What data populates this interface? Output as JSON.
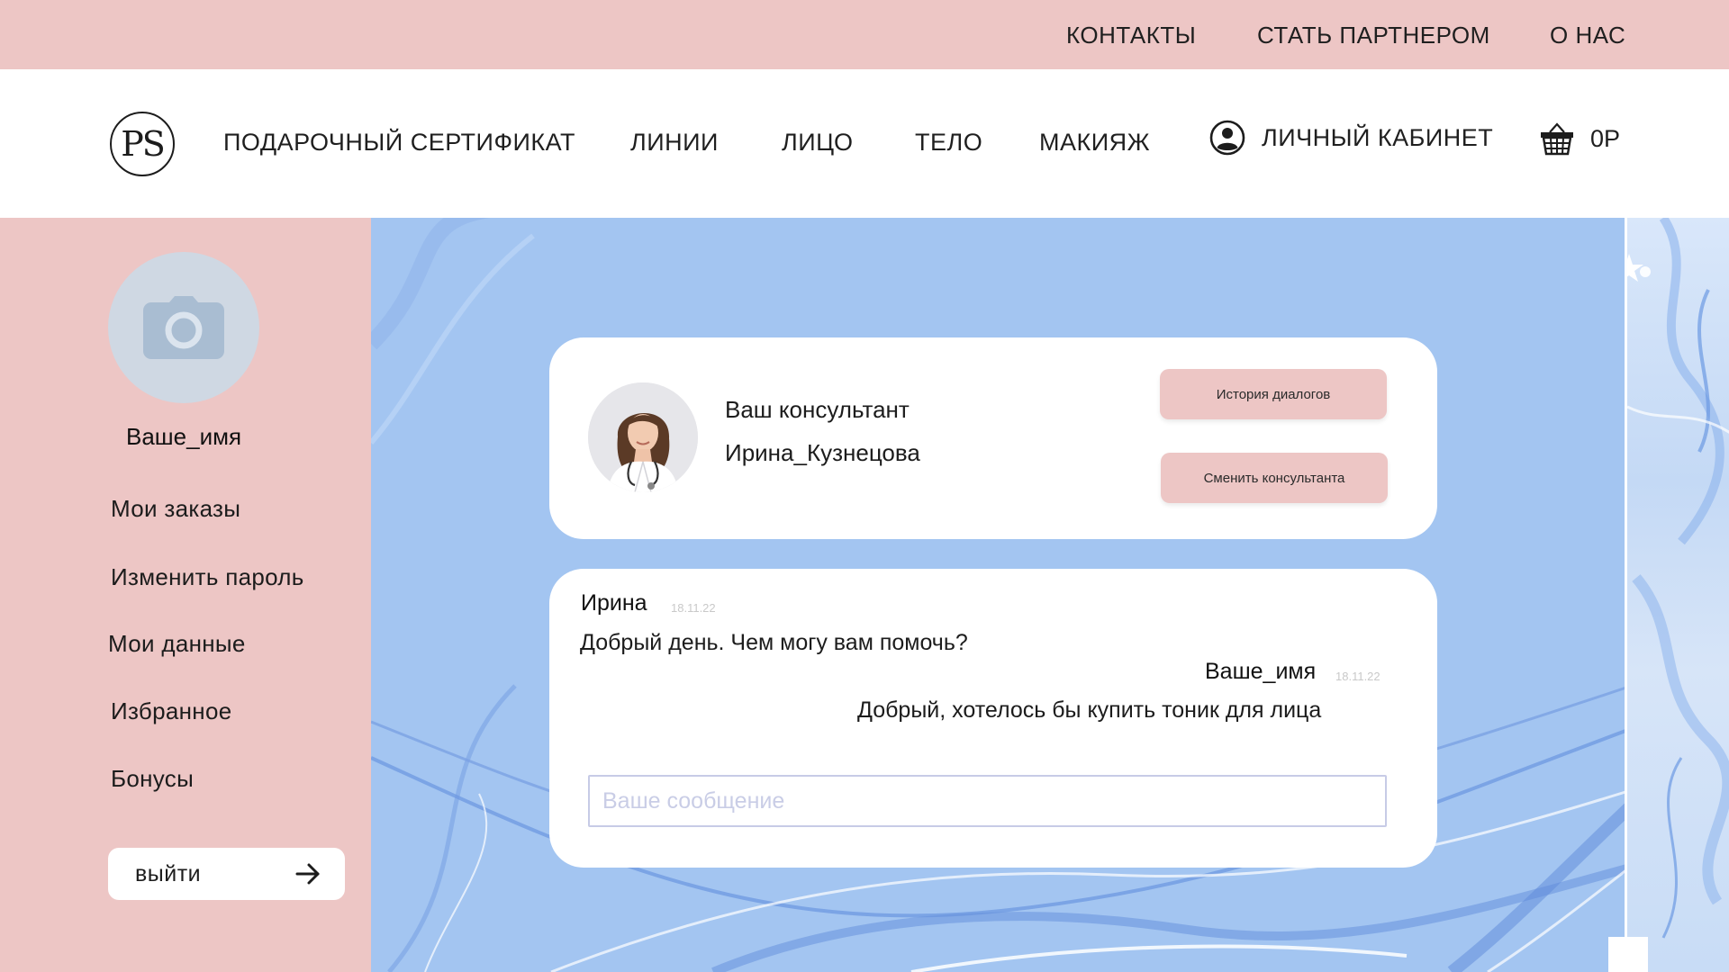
{
  "topbar": {
    "contacts": "КОНТАКТЫ",
    "partner": "СТАТЬ ПАРТНЕРОМ",
    "about": "О НАС"
  },
  "nav": {
    "logo": "PS",
    "gift_certificate": "ПОДАРОЧНЫЙ СЕРТИФИКАТ",
    "lines": "ЛИНИИ",
    "face": "ЛИЦО",
    "body": "ТЕЛО",
    "makeup": "МАКИЯЖ",
    "account": "ЛИЧНЫЙ КАБИНЕТ",
    "account_icon": "user-circle-icon",
    "cart_icon": "basket-icon",
    "cart_total": "0Р"
  },
  "sidebar": {
    "avatar_icon": "camera-icon",
    "user_name": "Ваше_имя",
    "items": [
      {
        "label": "Мои заказы"
      },
      {
        "label": "Изменить пароль"
      },
      {
        "label": "Мои данные"
      },
      {
        "label": "Избранное"
      },
      {
        "label": "Бонусы"
      }
    ],
    "logout_label": "выйти",
    "logout_icon": "arrow-right-icon"
  },
  "consultant": {
    "title": "Ваш консультант",
    "name": "Ирина_Кузнецова",
    "history_button": "История диалогов",
    "change_button": "Сменить консультанта"
  },
  "chat": {
    "messages": [
      {
        "sender": "Ирина",
        "date": "18.11.22",
        "text": "Добрый день. Чем могу вам помочь?"
      },
      {
        "sender": "Ваше_имя",
        "date": "18.11.22",
        "text": "Добрый, хотелось бы купить тоник для лица"
      }
    ],
    "input_placeholder": "Ваше сообщение"
  },
  "colors": {
    "pink": "#edc6c5",
    "blue": "#a3c5f1",
    "white": "#ffffff",
    "text": "#1c1c1c"
  }
}
